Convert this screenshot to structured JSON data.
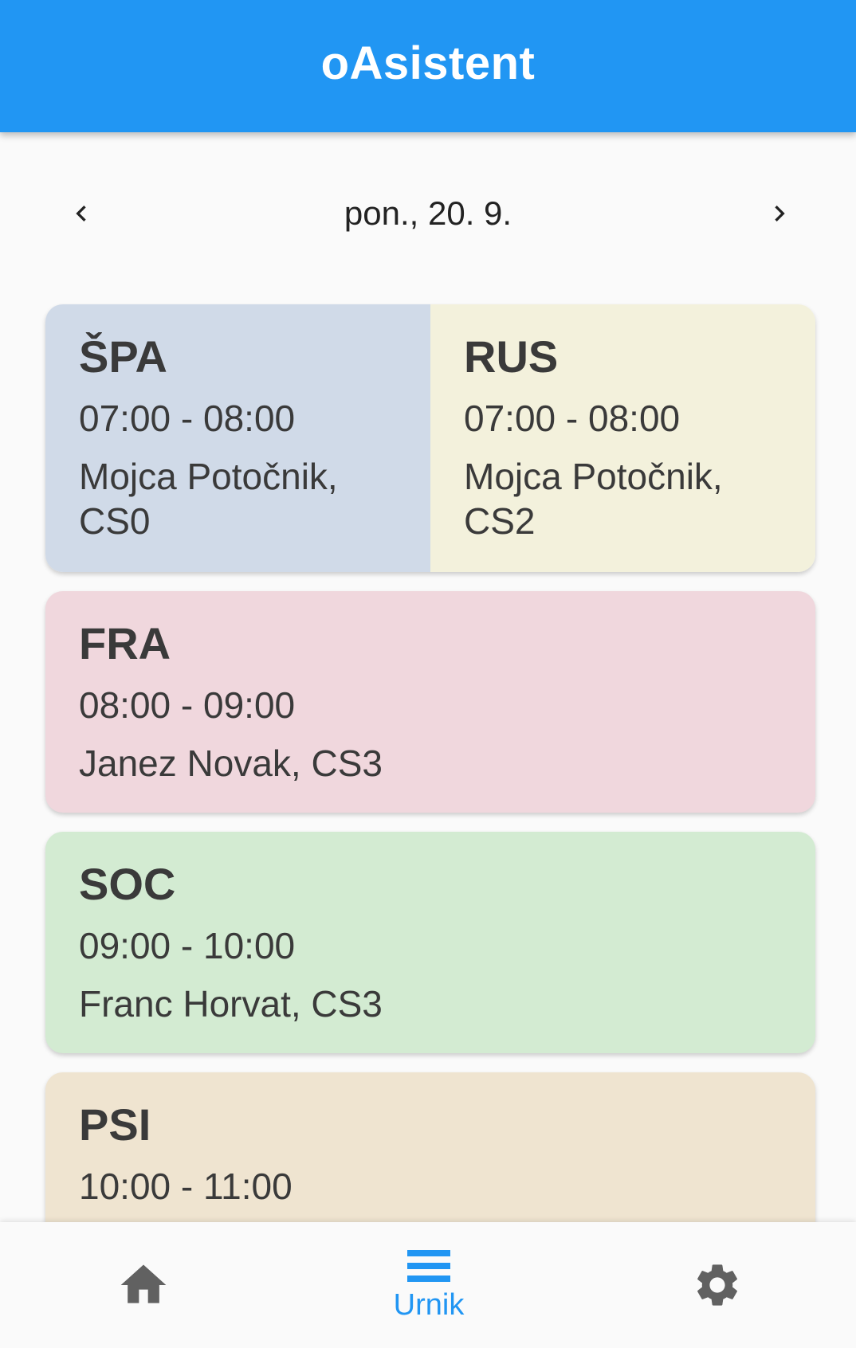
{
  "appbar": {
    "title": "oAsistent",
    "color": "#2196f3"
  },
  "date_nav": {
    "prev_icon": "chevron-left-icon",
    "label": "pon., 20. 9.",
    "next_icon": "chevron-right-icon"
  },
  "lessons": [
    {
      "subject": "ŠPA",
      "time": "07:00 - 08:00",
      "detail": "Mojca Potočnik,\nCS0",
      "color": "#d0dae8"
    },
    {
      "subject": "RUS",
      "time": "07:00 - 08:00",
      "detail": "Mojca Potočnik,\nCS2",
      "color": "#f3f1dc"
    },
    {
      "subject": "FRA",
      "time": "08:00 - 09:00",
      "detail": "Janez Novak, CS3",
      "color": "#f0d7dd"
    },
    {
      "subject": "SOC",
      "time": "09:00 - 10:00",
      "detail": "Franc Horvat, CS3",
      "color": "#d3ebd2"
    },
    {
      "subject": "PSI",
      "time": "10:00 - 11:00",
      "detail": "",
      "color": "#efe4d0"
    }
  ],
  "bottom_nav": {
    "items": [
      {
        "icon": "home-icon",
        "label": ""
      },
      {
        "icon": "schedule-list-icon",
        "label": "Urnik",
        "active": true
      },
      {
        "icon": "gear-icon",
        "label": ""
      }
    ],
    "active_color": "#2196f3",
    "inactive_color": "#616161"
  }
}
